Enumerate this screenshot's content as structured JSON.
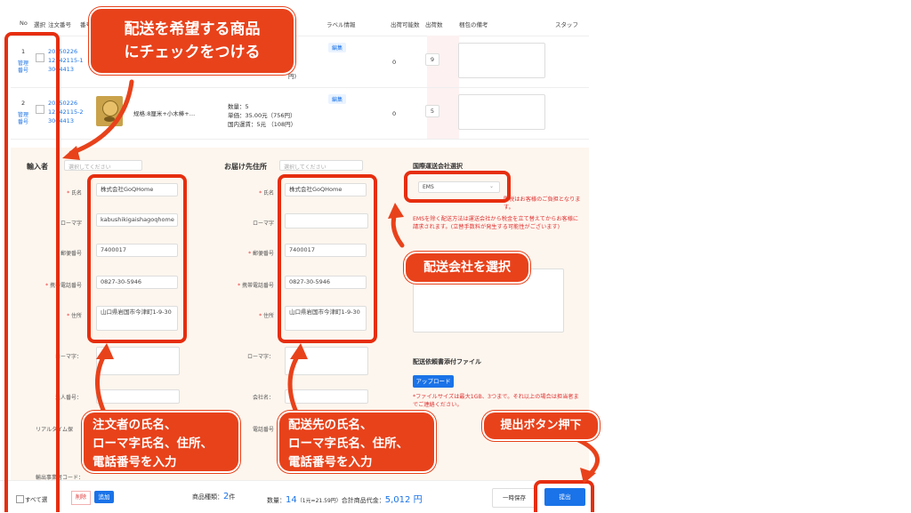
{
  "table": {
    "headers": [
      "No",
      "選択",
      "注文番号",
      "番号",
      "ラベル情報",
      "出荷可能数",
      "出荷数",
      "梱包の備考",
      "スタッフ"
    ],
    "rows": [
      {
        "no": "1",
        "admin": "管理番号",
        "order_line1": "20250226",
        "order_line2": "12342115-1",
        "order_line3": "3004413",
        "label": "編集",
        "available": "0",
        "ship_qty": "9",
        "spec": "",
        "qty": "",
        "price": "",
        "domestic": "",
        "suffix": "円)"
      },
      {
        "no": "2",
        "admin": "管理番号",
        "order_line1": "20250226",
        "order_line2": "12342115-2",
        "order_line3": "3004413",
        "label": "編集",
        "available": "0",
        "ship_qty": "5",
        "spec": "规格:8厘米+小木棒+…",
        "qty": "数量：5",
        "price": "単価：35.00元（756円）",
        "domestic": "国内運賃：5元 （108円）",
        "suffix": ""
      }
    ]
  },
  "importer": {
    "title": "輸入者",
    "select_placeholder": "選択してください",
    "name_label": "氏名",
    "name_value": "株式会社GoQHome",
    "romaji_label": "ローマ字",
    "romaji_value": "kabushikigaishagoqhome",
    "zip_label": "郵便番号",
    "zip_value": "7400017",
    "phone_label": "携帯電話番号",
    "phone_value": "0827-30-5946",
    "address_label": "住所",
    "address_value": "山口県岩国市今津町1-9-30",
    "address_romaji_label": "ローマ字：",
    "corp_label": "法人番号：",
    "real_label": "リアルタイム保",
    "code_label": "輸出事業者コード："
  },
  "recipient": {
    "title": "お届け先住所",
    "select_placeholder": "選択してください",
    "name_label": "氏名",
    "name_value": "株式会社GoQHome",
    "romaji_label": "ローマ字",
    "zip_label": "郵便番号",
    "zip_value": "7400017",
    "phone_label": "携帯電話番号",
    "phone_value": "0827-30-5946",
    "address_label": "住所",
    "address_value": "山口県岩国市今津町1-9-30",
    "address_romaji_label": "ローマ字：",
    "company_label": "会社名：",
    "tel_label": "電話番号"
  },
  "shipping": {
    "title": "国際運送会社選択",
    "carrier": "EMS",
    "note1": "関税はお客様のご負担となります。",
    "note2": "EMSを除く配送方法は運送会社から税金を立て替えてからお客様に請求されます。(立替手数料が発生する可能性がございます)",
    "upload_title": "配送依頼書添付ファイル",
    "upload_button": "アップロード",
    "upload_note": "*ファイルサイズは最大1GB、3つまで。それ以上の場合は担当者までご連絡ください。"
  },
  "footer": {
    "select_all": "すべて選",
    "delete": "削除",
    "add": "追加",
    "kinds_label": "商品種類：",
    "kinds_value": "2",
    "kinds_unit": "件",
    "qty_label": "数量：",
    "qty_value": "14",
    "rate": "（1元=21.59円）",
    "total_label": "合計商品代金：",
    "total_value": "5,012 円",
    "save": "一時保存",
    "submit": "提出"
  },
  "callouts": {
    "check": "配送を希望する商品\nにチェックをつける",
    "carrier": "配送会社を選択",
    "importer": "注文者の氏名、\nローマ字氏名、住所、\n電話番号を入力",
    "recipient": "配送先の氏名、\nローマ字氏名、住所、\n電話番号を入力",
    "submit": "提出ボタン押下"
  },
  "colors": {
    "accent": "#e8421b",
    "box": "#e62e0f",
    "link": "#1a73e8",
    "form_bg": "#fdf6ee"
  }
}
